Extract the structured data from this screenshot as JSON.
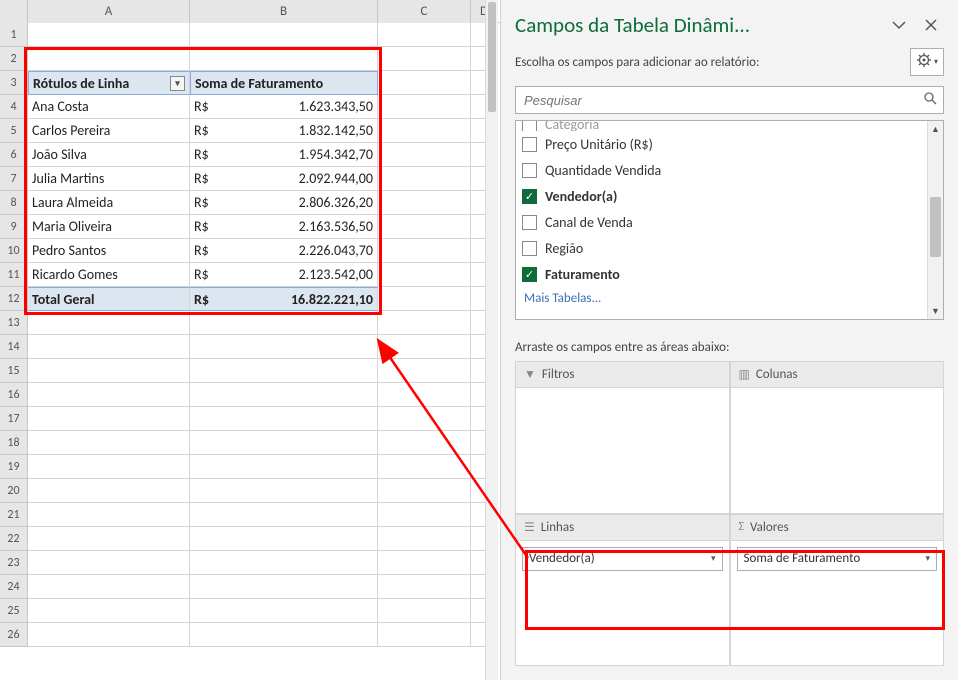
{
  "columns": [
    "A",
    "B",
    "C",
    "D"
  ],
  "rowStart": 1,
  "rowEnd": 26,
  "pivot": {
    "headerRow": 3,
    "rowLabelHeader": "Rótulos de Linha",
    "valueHeader": "Soma de Faturamento",
    "rows": [
      {
        "label": "Ana Costa",
        "currency": "R$",
        "value": "1.623.343,50"
      },
      {
        "label": "Carlos Pereira",
        "currency": "R$",
        "value": "1.832.142,50"
      },
      {
        "label": "João Silva",
        "currency": "R$",
        "value": "1.954.342,70"
      },
      {
        "label": "Julia Martins",
        "currency": "R$",
        "value": "2.092.944,00"
      },
      {
        "label": "Laura Almeida",
        "currency": "R$",
        "value": "2.806.326,20"
      },
      {
        "label": "Maria Oliveira",
        "currency": "R$",
        "value": "2.163.536,50"
      },
      {
        "label": "Pedro Santos",
        "currency": "R$",
        "value": "2.226.043,70"
      },
      {
        "label": "Ricardo Gomes",
        "currency": "R$",
        "value": "2.123.542,00"
      }
    ],
    "total": {
      "label": "Total Geral",
      "currency": "R$",
      "value": "16.822.221,10"
    }
  },
  "pane": {
    "title": "Campos da Tabela Dinâmi...",
    "subtitle": "Escolha os campos para adicionar ao relatório:",
    "searchPlaceholder": "Pesquisar",
    "truncatedField": "Categoria",
    "fields": [
      {
        "label": "Preço Unitário (R$)",
        "checked": false
      },
      {
        "label": "Quantidade Vendida",
        "checked": false
      },
      {
        "label": "Vendedor(a)",
        "checked": true
      },
      {
        "label": "Canal de Venda",
        "checked": false
      },
      {
        "label": "Região",
        "checked": false
      },
      {
        "label": "Faturamento",
        "checked": true
      }
    ],
    "moreTables": "Mais Tabelas...",
    "dragLabel": "Arraste os campos entre as áreas abaixo:",
    "areas": {
      "filters": {
        "title": "Filtros"
      },
      "columns": {
        "title": "Colunas"
      },
      "rows": {
        "title": "Linhas",
        "items": [
          "Vendedor(a)"
        ]
      },
      "values": {
        "title": "Valores",
        "items": [
          "Soma de Faturamento"
        ]
      }
    }
  }
}
